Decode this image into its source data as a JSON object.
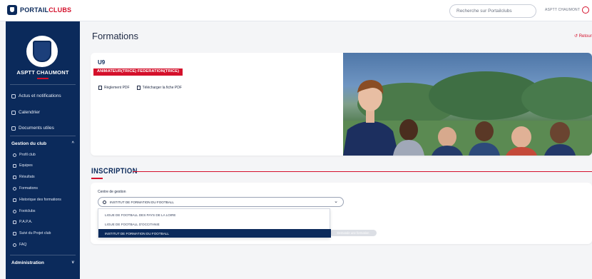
{
  "header": {
    "logo_main": "PORTAIL",
    "logo_accent": "CLUBS",
    "search_placeholder": "Recherche sur Portailclubs",
    "user_name": "ASPTT CHAUMONT"
  },
  "sidebar": {
    "club_name": "ASPTT CHAUMONT",
    "main_items": [
      {
        "label": "Actus et notifications"
      },
      {
        "label": "Calendrier"
      },
      {
        "label": "Documents utiles"
      }
    ],
    "section_title": "Gestion du club",
    "sub_items": [
      {
        "label": "Profil club"
      },
      {
        "label": "Equipes"
      },
      {
        "label": "Résultats"
      },
      {
        "label": "Formations"
      },
      {
        "label": "Historique des formations"
      },
      {
        "label": "Footclubs"
      },
      {
        "label": "P.A.P.A."
      },
      {
        "label": "Suivi du Projet club"
      },
      {
        "label": "FAQ"
      }
    ],
    "admin_title": "Administration"
  },
  "page": {
    "title": "Formations",
    "back_label": "Retour"
  },
  "card": {
    "level": "U9",
    "tag": "ANIMATEUR(TRICE) FEDERATION(TRICE)",
    "links": [
      {
        "label": "Règlement PDF"
      },
      {
        "label": "Télécharger la fiche PDF"
      }
    ]
  },
  "inscription": {
    "title": "INSCRIPTION",
    "field_label": "Centre de gestion",
    "selected_value": "INSTITUT DE FORMATION DU FOOTBALL",
    "options": [
      {
        "label": "LIGUE DE FOOTBALL DES PAYS DE LA LOIRE"
      },
      {
        "label": "LIGUE DE FOOTBALL D'OCCITANIE"
      },
      {
        "label": "INSTITUT DE FORMATION DU FOOTBALL"
      }
    ],
    "ghost_button": "Demande une formation"
  },
  "colors": {
    "navy": "#0b2a5b",
    "accent_red": "#d4102b",
    "background": "#f4f5f7"
  }
}
